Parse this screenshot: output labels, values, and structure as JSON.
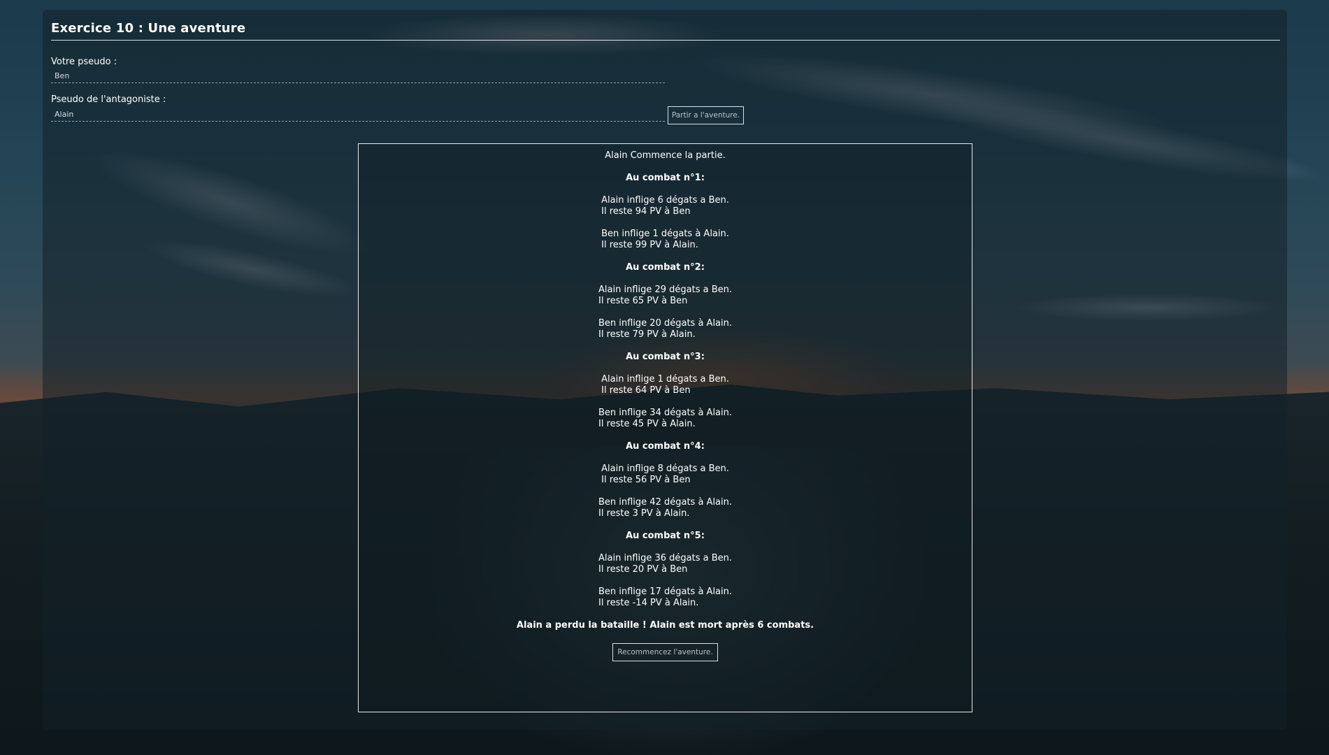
{
  "page": {
    "title": "Exercice 10 : Une aventure"
  },
  "form": {
    "player_label": "Votre pseudo :",
    "player_value": "Ben",
    "enemy_label": "Pseudo de l'antagoniste :",
    "enemy_value": "Alain",
    "start_button": "Partir a l'aventure."
  },
  "log": {
    "intro": "Alain Commence la partie.",
    "rounds": [
      {
        "title": "Au combat n°1:",
        "attacks": [
          {
            "line1": "Alain inflige 6 dégats a Ben.",
            "line2": "Il reste 94 PV à Ben"
          },
          {
            "line1": "Ben inflige 1 dégats à Alain.",
            "line2": "Il reste 99 PV à Alain."
          }
        ]
      },
      {
        "title": "Au combat n°2:",
        "attacks": [
          {
            "line1": "Alain inflige 29 dégats a Ben.",
            "line2": "Il reste 65 PV à Ben"
          },
          {
            "line1": "Ben inflige 20 dégats à Alain.",
            "line2": "Il reste 79 PV à Alain."
          }
        ]
      },
      {
        "title": "Au combat n°3:",
        "attacks": [
          {
            "line1": "Alain inflige 1 dégats a Ben.",
            "line2": "Il reste 64 PV à Ben"
          },
          {
            "line1": "Ben inflige 34 dégats à Alain.",
            "line2": "Il reste 45 PV à Alain."
          }
        ]
      },
      {
        "title": "Au combat n°4:",
        "attacks": [
          {
            "line1": "Alain inflige 8 dégats a Ben.",
            "line2": "Il reste 56 PV à Ben"
          },
          {
            "line1": "Ben inflige 42 dégats à Alain.",
            "line2": "Il reste 3 PV à Alain."
          }
        ]
      },
      {
        "title": "Au combat n°5:",
        "attacks": [
          {
            "line1": "Alain inflige 36 dégats a Ben.",
            "line2": "Il reste 20 PV à Ben"
          },
          {
            "line1": "Ben inflige 17 dégats à Alain.",
            "line2": "Il reste -14 PV à Alain."
          }
        ]
      }
    ],
    "result": "Alain a perdu la bataille ! Alain est mort après 6 combats.",
    "restart_button": "Recommencez l'aventure."
  }
}
